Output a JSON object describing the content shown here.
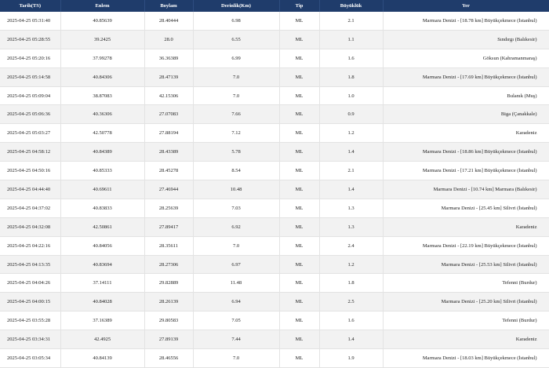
{
  "headers": {
    "date": "Tarih(TS)",
    "lat": "Enlem",
    "lon": "Boylam",
    "depth": "Derinlik(Km)",
    "type": "Tip",
    "magnitude": "Büyüklük",
    "place": "Yer"
  },
  "rows": [
    {
      "date": "2025-04-25 05:31:40",
      "lat": "40.85639",
      "lon": "28.40444",
      "depth": "6.98",
      "type": "ML",
      "mag": "2.1",
      "place": "Marmara Denizi - [18.78 km] Büyükçekmece (İstanbul)"
    },
    {
      "date": "2025-04-25 05:28:55",
      "lat": "39.2425",
      "lon": "28.0",
      "depth": "6.55",
      "type": "ML",
      "mag": "1.1",
      "place": "Sındırgı (Balıkesir)"
    },
    {
      "date": "2025-04-25 05:20:16",
      "lat": "37.99278",
      "lon": "36.36389",
      "depth": "6.99",
      "type": "ML",
      "mag": "1.6",
      "place": "Göksun (Kahramanmaraş)"
    },
    {
      "date": "2025-04-25 05:14:58",
      "lat": "40.84306",
      "lon": "28.47139",
      "depth": "7.0",
      "type": "ML",
      "mag": "1.8",
      "place": "Marmara Denizi - [17.69 km] Büyükçekmece (İstanbul)"
    },
    {
      "date": "2025-04-25 05:09:04",
      "lat": "38.87083",
      "lon": "42.15306",
      "depth": "7.0",
      "type": "ML",
      "mag": "1.0",
      "place": "Bulanık (Muş)"
    },
    {
      "date": "2025-04-25 05:06:36",
      "lat": "40.36306",
      "lon": "27.07083",
      "depth": "7.66",
      "type": "ML",
      "mag": "0.9",
      "place": "Biga (Çanakkale)"
    },
    {
      "date": "2025-04-25 05:03:27",
      "lat": "42.50778",
      "lon": "27.88194",
      "depth": "7.12",
      "type": "ML",
      "mag": "1.2",
      "place": "Karadeniz"
    },
    {
      "date": "2025-04-25 04:58:12",
      "lat": "40.84389",
      "lon": "28.43389",
      "depth": "5.78",
      "type": "ML",
      "mag": "1.4",
      "place": "Marmara Denizi - [18.86 km] Büyükçekmece (İstanbul)"
    },
    {
      "date": "2025-04-25 04:50:16",
      "lat": "40.85333",
      "lon": "28.45278",
      "depth": "8.54",
      "type": "ML",
      "mag": "2.1",
      "place": "Marmara Denizi - [17.21 km] Büyükçekmece (İstanbul)"
    },
    {
      "date": "2025-04-25 04:44:40",
      "lat": "40.69611",
      "lon": "27.46944",
      "depth": "10.48",
      "type": "ML",
      "mag": "1.4",
      "place": "Marmara Denizi - [10.74 km] Marmara (Balıkesir)"
    },
    {
      "date": "2025-04-25 04:37:02",
      "lat": "40.83833",
      "lon": "28.25639",
      "depth": "7.03",
      "type": "ML",
      "mag": "1.3",
      "place": "Marmara Denizi - [25.45 km] Silivri (İstanbul)"
    },
    {
      "date": "2025-04-25 04:32:08",
      "lat": "42.50861",
      "lon": "27.89417",
      "depth": "6.92",
      "type": "ML",
      "mag": "1.3",
      "place": "Karadeniz"
    },
    {
      "date": "2025-04-25 04:22:16",
      "lat": "40.84056",
      "lon": "28.35611",
      "depth": "7.0",
      "type": "ML",
      "mag": "2.4",
      "place": "Marmara Denizi - [22.19 km] Büyükçekmece (İstanbul)"
    },
    {
      "date": "2025-04-25 04:13:35",
      "lat": "40.83694",
      "lon": "28.27306",
      "depth": "6.97",
      "type": "ML",
      "mag": "1.2",
      "place": "Marmara Denizi - [25.53 km] Silivri (İstanbul)"
    },
    {
      "date": "2025-04-25 04:04:26",
      "lat": "37.14111",
      "lon": "29.82889",
      "depth": "11.48",
      "type": "ML",
      "mag": "1.8",
      "place": "Tefenni (Burdur)"
    },
    {
      "date": "2025-04-25 04:00:15",
      "lat": "40.84028",
      "lon": "28.26139",
      "depth": "6.94",
      "type": "ML",
      "mag": "2.5",
      "place": "Marmara Denizi - [25.20 km] Silivri (İstanbul)"
    },
    {
      "date": "2025-04-25 03:55:28",
      "lat": "37.16389",
      "lon": "29.80583",
      "depth": "7.05",
      "type": "ML",
      "mag": "1.6",
      "place": "Tefenni (Burdur)"
    },
    {
      "date": "2025-04-25 03:34:31",
      "lat": "42.4925",
      "lon": "27.89139",
      "depth": "7.44",
      "type": "ML",
      "mag": "1.4",
      "place": "Karadeniz"
    },
    {
      "date": "2025-04-25 03:05:34",
      "lat": "40.84139",
      "lon": "28.46556",
      "depth": "7.0",
      "type": "ML",
      "mag": "1.9",
      "place": "Marmara Denizi - [18.03 km] Büyükçekmece (İstanbul)"
    }
  ]
}
